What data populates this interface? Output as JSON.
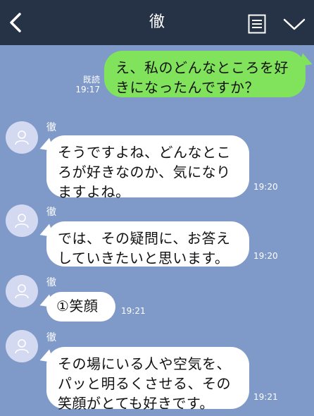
{
  "header": {
    "title": "徹",
    "back_icon": "chevron-left-icon",
    "menu_icon": "list-icon",
    "expand_icon": "chevron-down-icon"
  },
  "colors": {
    "header_bg": "#263246",
    "chat_bg": "#7f9ac9",
    "outgoing_bubble": "#80e35b",
    "incoming_bubble": "#ffffff",
    "avatar_bg": "#d4d9f2"
  },
  "messages": [
    {
      "direction": "outgoing",
      "text": "え、私のどんなところを好\nきになったんですか？",
      "read_label": "既読",
      "time": "19:17"
    },
    {
      "direction": "incoming",
      "sender": "徹",
      "text": "そうですよね、どんなとこ\nろが好きなのか、気になり\nますよね。",
      "time": "19:20"
    },
    {
      "direction": "incoming",
      "sender": "徹",
      "text": "では、その疑問に、お答え\nしていきたいと思います。",
      "time": "19:20"
    },
    {
      "direction": "incoming",
      "sender": "徹",
      "text": "①笑顔",
      "time": "19:21"
    },
    {
      "direction": "incoming",
      "sender": "徹",
      "text": "その場にいる人や空気を、\nパッと明るくさせる、その\n笑顔がとても好きです。",
      "time": "19:21"
    }
  ]
}
